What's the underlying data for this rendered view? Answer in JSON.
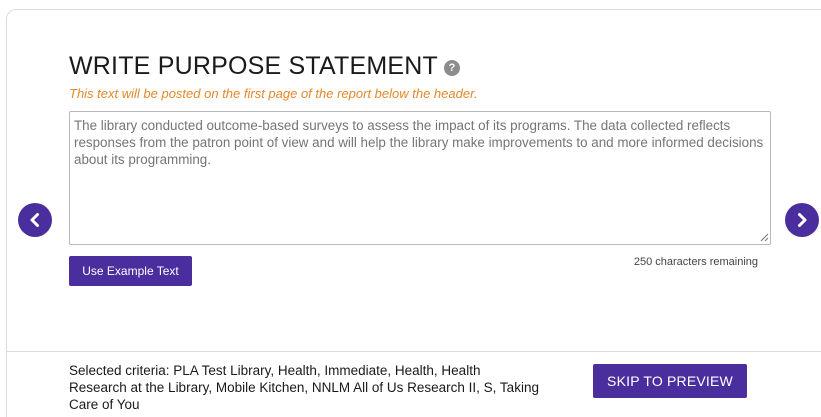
{
  "header": {
    "title": "WRITE PURPOSE STATEMENT",
    "help_icon": "question-circle-icon",
    "subtitle": "This text will be posted on the first page of the report below the header."
  },
  "editor": {
    "placeholder": "The library conducted outcome-based surveys to assess the impact of its programs. The data collected reflects responses from the patron point of view and will help the library make improvements to and more informed decisions about its programming.",
    "value": "",
    "characters_remaining": "250 characters remaining"
  },
  "actions": {
    "example_label": "Use Example Text",
    "skip_label": "SKIP TO PREVIEW"
  },
  "navigation": {
    "prev_icon": "chevron-left-circle-icon",
    "next_icon": "chevron-right-circle-icon"
  },
  "footer": {
    "criteria": "Selected criteria: PLA Test Library, Health, Immediate, Health, Health Research at the Library, Mobile Kitchen, NNLM All of Us Research II, S, Taking Care of You"
  },
  "colors": {
    "accent": "#4b2e9e",
    "subtitle": "#e4882a",
    "border": "#dcdcdc"
  }
}
